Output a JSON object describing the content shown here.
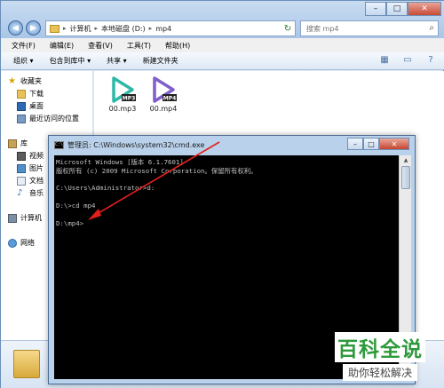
{
  "explorer": {
    "breadcrumbs": [
      "计算机",
      "本地磁盘 (D:)",
      "mp4"
    ],
    "search_placeholder": "搜索 mp4",
    "menu": [
      "文件(F)",
      "编辑(E)",
      "查看(V)",
      "工具(T)",
      "帮助(H)"
    ],
    "toolbar": [
      "组织 ▾",
      "包含到库中 ▾",
      "共享 ▾",
      "新建文件夹"
    ],
    "nav": {
      "favorites": "收藏夹",
      "downloads": "下载",
      "desktop": "桌面",
      "recent": "最近访问的位置",
      "libraries": "库",
      "videos": "视频",
      "pictures": "图片",
      "documents": "文档",
      "music": "音乐",
      "computer": "计算机",
      "network": "网络"
    },
    "files": [
      {
        "name": "00.mp3",
        "badge": "MP3",
        "color": "#2fb8a8"
      },
      {
        "name": "00.mp4",
        "badge": "MP4",
        "color": "#7f5fc9"
      }
    ]
  },
  "cmd": {
    "title": "管理员: C:\\Windows\\system32\\cmd.exe",
    "icon_text": "C:\\",
    "lines": [
      "Microsoft Windows [版本 6.1.7601]",
      "版权所有 (c) 2009 Microsoft Corporation。保留所有权利。",
      "",
      "C:\\Users\\Administrator>d:",
      "",
      "D:\\>cd mp4",
      "",
      "D:\\mp4>"
    ]
  },
  "watermark": {
    "main": "百科全说",
    "sub": "助你轻松解决"
  },
  "colors": {
    "annotation_arrow": "#e0201c",
    "watermark_green": "#2f9a3c"
  }
}
